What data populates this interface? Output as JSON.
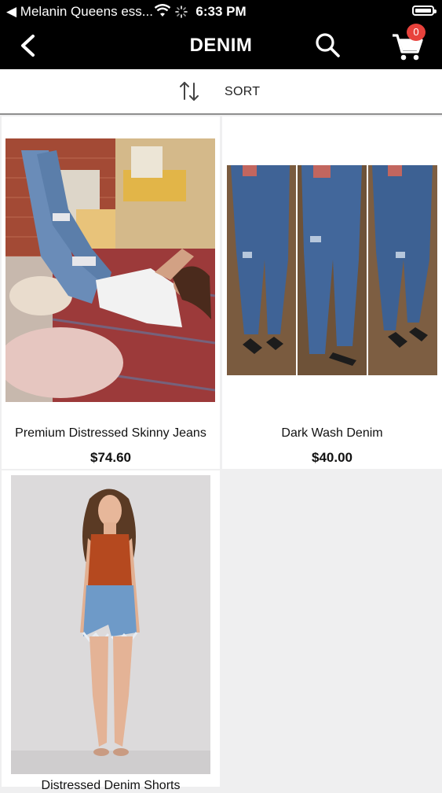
{
  "status_bar": {
    "carrier": "◀ Melanin Queens ess...",
    "time": "6:33 PM"
  },
  "header": {
    "title": "DENIM",
    "cart_count": "0"
  },
  "sort": {
    "label": "SORT"
  },
  "products": [
    {
      "name": "Premium Distressed Skinny Jeans",
      "price": "$74.60"
    },
    {
      "name": "Dark Wash Denim",
      "price": "$40.00"
    },
    {
      "name": "Distressed Denim Shorts",
      "price": ""
    }
  ],
  "colors": {
    "accent_badge": "#e8423c",
    "bar_background": "#000000"
  }
}
